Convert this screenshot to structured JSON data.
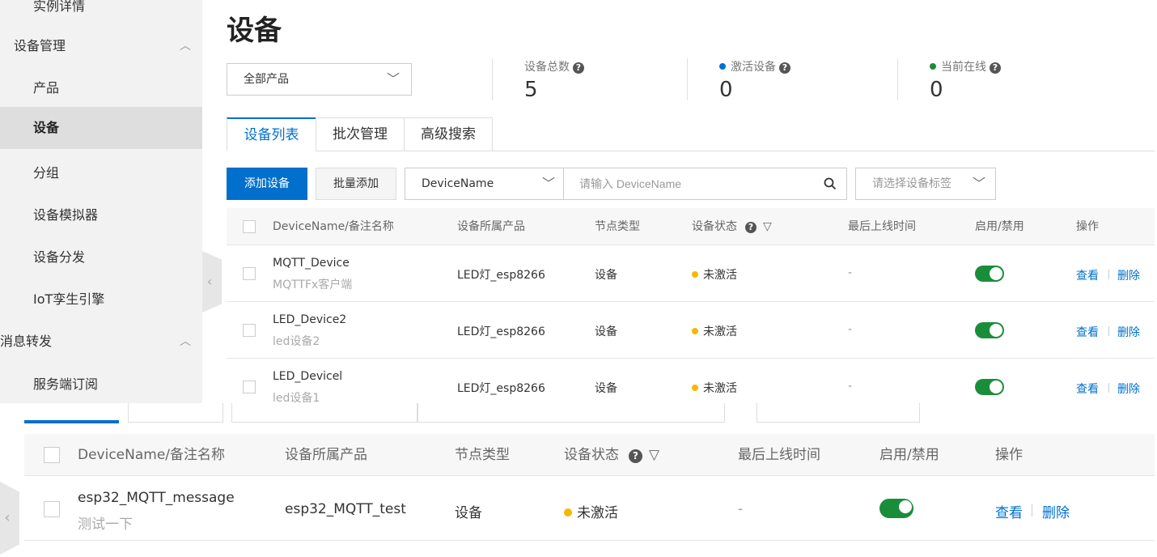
{
  "sidebar": {
    "partial_top_item": "实例详情",
    "groups": [
      {
        "label": "设备管理",
        "expanded": true,
        "items": [
          "产品",
          "设备",
          "分组",
          "设备模拟器",
          "设备分发",
          "IoT孪生引擎"
        ]
      },
      {
        "label": "消息转发",
        "expanded": true,
        "items": [
          "服务端订阅"
        ]
      }
    ],
    "active_item": "设备"
  },
  "header": {
    "title": "设备"
  },
  "product_filter": {
    "selected": "全部产品"
  },
  "stats": {
    "total": {
      "label": "设备总数",
      "value": "5"
    },
    "activated": {
      "label": "激活设备",
      "value": "0",
      "dot_color": "#0070cc"
    },
    "online": {
      "label": "当前在线",
      "value": "0",
      "dot_color": "#1a8d3b"
    }
  },
  "tabs": [
    "设备列表",
    "批次管理",
    "高级搜索"
  ],
  "toolbar": {
    "add_label": "添加设备",
    "batch_add_label": "批量添加",
    "field_select": "DeviceName",
    "search_placeholder": "请输入 DeviceName",
    "tag_placeholder": "请选择设备标签"
  },
  "table": {
    "columns": [
      "DeviceName/备注名称",
      "设备所属产品",
      "节点类型",
      "设备状态",
      "最后上线时间",
      "启用/禁用",
      "操作"
    ],
    "rows": [
      {
        "name": "MQTT_Device",
        "note": "MQTTFx客户端",
        "product": "LED灯_esp8266",
        "node": "设备",
        "status": "未激活",
        "last_online": "-",
        "enabled": true,
        "view": "查看",
        "delete": "删除"
      },
      {
        "name": "LED_Device2",
        "note": "led设备2",
        "product": "LED灯_esp8266",
        "node": "设备",
        "status": "未激活",
        "last_online": "-",
        "enabled": true,
        "view": "查看",
        "delete": "删除"
      },
      {
        "name": "LED_Devicel",
        "note": "led设备1",
        "product": "LED灯_esp8266",
        "node": "设备",
        "status": "未激活",
        "last_online": "-",
        "enabled": true,
        "view": "查看",
        "delete": "删除"
      }
    ]
  },
  "lower_table": {
    "columns": [
      "DeviceName/备注名称",
      "设备所属产品",
      "节点类型",
      "设备状态",
      "最后上线时间",
      "启用/禁用",
      "操作"
    ],
    "row": {
      "name": "esp32_MQTT_message",
      "note": "测试一下",
      "product": "esp32_MQTT_test",
      "node": "设备",
      "status": "未激活",
      "last_online": "-",
      "enabled": true,
      "view": "查看",
      "delete": "删除"
    }
  },
  "colors": {
    "primary": "#0070cc",
    "toggle_on": "#1a8d3b",
    "status_inactive": "#f5b800"
  }
}
